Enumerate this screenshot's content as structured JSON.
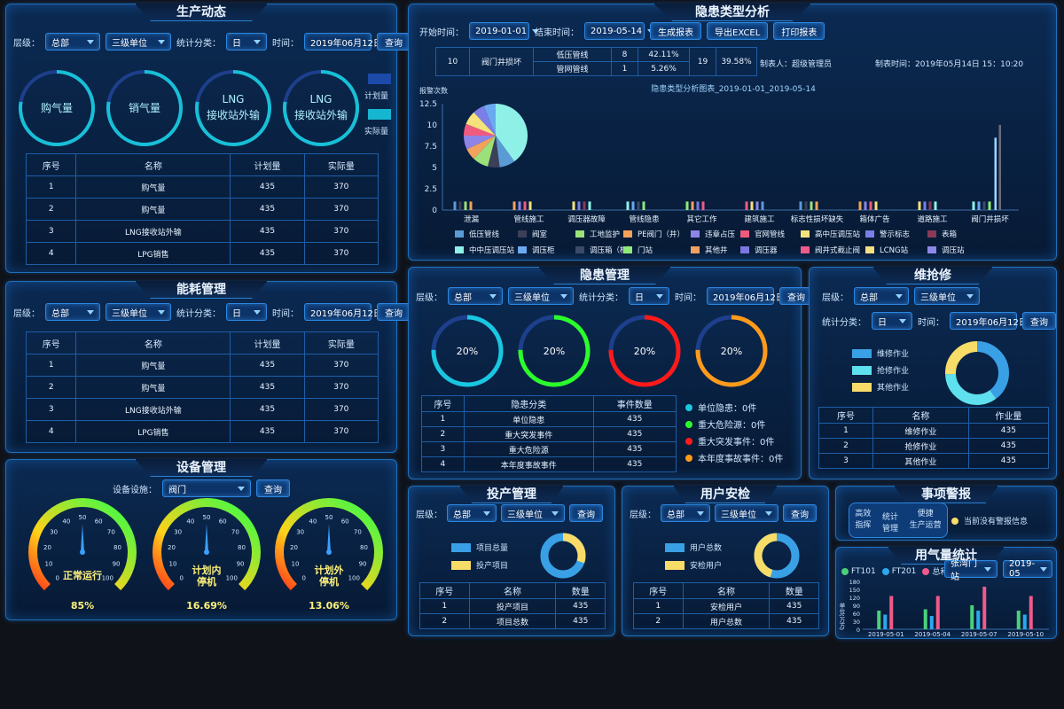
{
  "prod": {
    "title": "生产动态",
    "level_lbl": "层级：",
    "level": "总部",
    "unit": "三级单位",
    "stat_lbl": "统计分类：",
    "stat": "日",
    "time_lbl": "时间：",
    "date": "2019年06月12日",
    "query": "查询",
    "rings": [
      "购气量",
      "销气量",
      "LNG接收站外输",
      "LNG接收站外输"
    ],
    "plan": "计划量",
    "actual": "实际量",
    "cols": [
      "序号",
      "名称",
      "计划量",
      "实际量"
    ],
    "rows": [
      [
        "1",
        "购气量",
        "435",
        "370"
      ],
      [
        "2",
        "购气量",
        "435",
        "370"
      ],
      [
        "3",
        "LNG接收站外输",
        "435",
        "370"
      ],
      [
        "4",
        "LPG销售",
        "435",
        "370"
      ]
    ]
  },
  "energy": {
    "title": "能耗管理",
    "level_lbl": "层级：",
    "level": "总部",
    "unit": "三级单位",
    "stat_lbl": "统计分类：",
    "stat": "日",
    "time_lbl": "时间：",
    "date": "2019年06月12日",
    "query": "查询",
    "cols": [
      "序号",
      "名称",
      "计划量",
      "实际量"
    ],
    "rows": [
      [
        "1",
        "购气量",
        "435",
        "370"
      ],
      [
        "2",
        "购气量",
        "435",
        "370"
      ],
      [
        "3",
        "LNG接收站外输",
        "435",
        "370"
      ],
      [
        "4",
        "LPG销售",
        "435",
        "370"
      ]
    ]
  },
  "equip": {
    "title": "设备管理",
    "dev_lbl": "设备设施：",
    "dev": "阀门",
    "query": "查询",
    "gauges": [
      {
        "label": "正常运行",
        "value": "85%",
        "frac": 0.85
      },
      {
        "label": "计划内停机",
        "value": "16.69%",
        "frac": 0.1669
      },
      {
        "label": "计划外停机",
        "value": "13.06%",
        "frac": 0.1306
      }
    ],
    "ticks": [
      "0",
      "10",
      "20",
      "30",
      "40",
      "50",
      "60",
      "70",
      "80",
      "90",
      "100"
    ]
  },
  "hazard_type": {
    "title": "隐患类型分析",
    "start_lbl": "开始时间：",
    "start": "2019-01-01",
    "end_lbl": "结束时间：",
    "end": "2019-05-14",
    "b1": "生成报表",
    "b2": "导出EXCEL",
    "b3": "打印报表",
    "sum": {
      "c1": "10",
      "c2": "阀门井损坏",
      "r1": [
        "低压管线",
        "8",
        "42.11%"
      ],
      "r2": [
        "管网管线",
        "1",
        "5.26%"
      ],
      "c6": "19",
      "c7": "39.58%",
      "maker": "制表人：超级管理员",
      "time": "制表时间：2019年05月14日  15：10:20"
    }
  },
  "chart_data": {
    "type": "bar",
    "title": "隐患类型分析图表_2019-01-01_2019-05-14",
    "ylabel": "报警次数",
    "ylim": [
      0,
      12.5
    ],
    "yticks": [
      "12.5",
      "10",
      "7.5",
      "5",
      "2.5",
      "0"
    ],
    "categories": [
      "泄漏",
      "管线施工",
      "调压器故障",
      "管线隐患",
      "其它工作",
      "建筑施工",
      "标志性损坏缺失",
      "箱体广告",
      "道路施工",
      "阀门井损坏"
    ],
    "legend": [
      {
        "name": "低压管线",
        "color": "#5b9bd5"
      },
      {
        "name": "阀室",
        "color": "#3c3f58"
      },
      {
        "name": "工地监护",
        "color": "#9be07a"
      },
      {
        "name": "PE阀门（井）",
        "color": "#f2a25a"
      },
      {
        "name": "违章占压",
        "color": "#8e84e8"
      },
      {
        "name": "官网管线",
        "color": "#f05a7e"
      },
      {
        "name": "高中压调压站",
        "color": "#f5e27a"
      },
      {
        "name": "警示标志",
        "color": "#7b7de8"
      },
      {
        "name": "表箱",
        "color": "#8a3a58"
      },
      {
        "name": "中中压调压站",
        "color": "#8ff0e8"
      },
      {
        "name": "调压柜",
        "color": "#6aa8f0"
      },
      {
        "name": "调压箱（柜）",
        "color": "#3b4a6a"
      },
      {
        "name": "门站",
        "color": "#8ee87a"
      },
      {
        "name": "其他井",
        "color": "#f0a060"
      },
      {
        "name": "调压器",
        "color": "#7a78e0"
      },
      {
        "name": "阀井式截止阀",
        "color": "#f05a8a"
      },
      {
        "name": "LCNG站",
        "color": "#f5e080"
      },
      {
        "name": "调压站",
        "color": "#8c88e8"
      }
    ],
    "values": [
      1,
      1,
      1,
      1,
      1,
      1,
      1,
      1,
      1,
      8.5,
      10
    ]
  },
  "hazard": {
    "title": "隐患管理",
    "level_lbl": "层级：",
    "level": "总部",
    "unit": "三级单位",
    "stat_lbl": "统计分类：",
    "stat": "日",
    "time_lbl": "时间：",
    "date": "2019年06月12日",
    "query": "查询",
    "rings": [
      {
        "pct": "20%",
        "color": "#19c7e0"
      },
      {
        "pct": "20%",
        "color": "#2bff2b"
      },
      {
        "pct": "20%",
        "color": "#ff1a1a"
      },
      {
        "pct": "20%",
        "color": "#ff9a1a"
      }
    ],
    "cols": [
      "序号",
      "隐患分类",
      "事件数量"
    ],
    "rows": [
      [
        "1",
        "单位隐患",
        "435"
      ],
      [
        "2",
        "重大突发事件",
        "435"
      ],
      [
        "3",
        "重大危险源",
        "435"
      ],
      [
        "4",
        "本年度事故事件",
        "435"
      ]
    ],
    "legend": [
      "单位隐患：0件",
      "重大危险源：0件",
      "重大突发事件：0件",
      "本年度事故事件：0件"
    ]
  },
  "repair": {
    "title": "维抢修",
    "level_lbl": "层级：",
    "level": "总部",
    "unit": "三级单位",
    "stat_lbl": "统计分类：",
    "stat": "日",
    "time_lbl": "时间：",
    "date": "2019年06月12日",
    "query": "查询",
    "legend": [
      "维修作业",
      "抢修作业",
      "其他作业"
    ],
    "cols": [
      "序号",
      "名称",
      "作业量"
    ],
    "rows": [
      [
        "1",
        "维修作业",
        "435"
      ],
      [
        "2",
        "抢修作业",
        "435"
      ],
      [
        "3",
        "其他作业",
        "435"
      ]
    ]
  },
  "invest": {
    "title": "投产管理",
    "level_lbl": "层级：",
    "level": "总部",
    "unit": "三级单位",
    "query": "查询",
    "legend": [
      "项目总量",
      "投产项目"
    ],
    "cols": [
      "序号",
      "名称",
      "数量"
    ],
    "rows": [
      [
        "1",
        "投产项目",
        "435"
      ],
      [
        "2",
        "项目总数",
        "435"
      ]
    ]
  },
  "user": {
    "title": "用户安检",
    "level_lbl": "层级：",
    "level": "总部",
    "unit": "三级单位",
    "query": "查询",
    "legend": [
      "用户总数",
      "安检用户"
    ],
    "cols": [
      "序号",
      "名称",
      "数量"
    ],
    "rows": [
      [
        "1",
        "安检用户",
        "435"
      ],
      [
        "2",
        "用户总数",
        "435"
      ]
    ]
  },
  "alarm": {
    "title": "事项警报",
    "b1a": "高效",
    "b1b": "指挥",
    "b2a": "统计",
    "b2b": "管理",
    "b3a": "便捷",
    "b3b": "生产运营",
    "msg": "当前没有警报信息"
  },
  "gas": {
    "title": "用气量统计",
    "legend": [
      "FT101",
      "FT201",
      "总和"
    ],
    "station": "张湾门站",
    "month": "2019-05",
    "ylabel": "单位(万方)",
    "yticks": [
      "180",
      "150",
      "120",
      "90",
      "60",
      "30",
      "0"
    ],
    "x": [
      "2019-05-01",
      "2019-05-04",
      "2019-05-07",
      "2019-05-10"
    ],
    "series": [
      {
        "name": "FT101",
        "values": [
          70,
          75,
          90,
          70
        ]
      },
      {
        "name": "FT201",
        "values": [
          55,
          50,
          70,
          55
        ]
      },
      {
        "name": "总和",
        "values": [
          125,
          125,
          160,
          125
        ]
      }
    ]
  }
}
